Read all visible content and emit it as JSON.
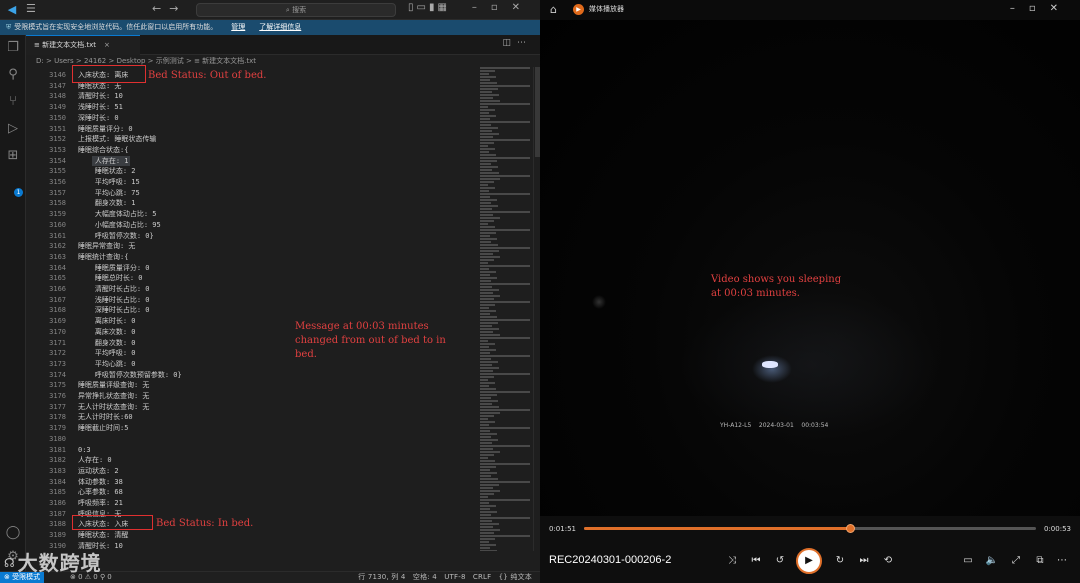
{
  "vscode": {
    "titlebar": {
      "search_placeholder": "搜索"
    },
    "banner": {
      "text": "受限模式旨在实现安全地浏览代码。信任此窗口以启用所有功能。",
      "manage_link": "管理",
      "learn_more_link": "了解详细信息"
    },
    "tab": {
      "label": "新建文本文档.txt",
      "close": "×"
    },
    "breadcrumb": "D: > Users > 24162 > Desktop > 示例测试 > ≡ 新建文本文档.txt",
    "code_lines": [
      {
        "n": "3146",
        "t": "入床状态: 离床"
      },
      {
        "n": "3147",
        "t": "睡眠状态: 无"
      },
      {
        "n": "3148",
        "t": "清醒时长: 10"
      },
      {
        "n": "3149",
        "t": "浅睡时长: 51"
      },
      {
        "n": "3150",
        "t": "深睡时长: 0"
      },
      {
        "n": "3151",
        "t": "睡眠质量评分: 0"
      },
      {
        "n": "3152",
        "t": "上报模式: 睡眠状态传输"
      },
      {
        "n": "3153",
        "t": "睡眠综合状态:{"
      },
      {
        "n": "3154",
        "t": "    人存在: 1"
      },
      {
        "n": "3155",
        "t": "    睡眠状态: 2"
      },
      {
        "n": "3156",
        "t": "    平均呼吸: 15"
      },
      {
        "n": "3157",
        "t": "    平均心跳: 75"
      },
      {
        "n": "3158",
        "t": "    翻身次数: 1"
      },
      {
        "n": "3159",
        "t": "    大幅度体动占比: 5"
      },
      {
        "n": "3160",
        "t": "    小幅度体动占比: 95"
      },
      {
        "n": "3161",
        "t": "    呼吸暂停次数: 0}"
      },
      {
        "n": "3162",
        "t": "睡眠异常查询: 无"
      },
      {
        "n": "3163",
        "t": "睡眠统计查询:{"
      },
      {
        "n": "3164",
        "t": "    睡眠质量评分: 0"
      },
      {
        "n": "3165",
        "t": "    睡眠总时长: 0"
      },
      {
        "n": "3166",
        "t": "    清醒时长占比: 0"
      },
      {
        "n": "3167",
        "t": "    浅睡时长占比: 0"
      },
      {
        "n": "3168",
        "t": "    深睡时长占比: 0"
      },
      {
        "n": "3169",
        "t": "    离床时长: 0"
      },
      {
        "n": "3170",
        "t": "    离床次数: 0"
      },
      {
        "n": "3171",
        "t": "    翻身次数: 0"
      },
      {
        "n": "3172",
        "t": "    平均呼吸: 0"
      },
      {
        "n": "3173",
        "t": "    平均心跳: 0"
      },
      {
        "n": "3174",
        "t": "    呼吸暂停次数预留参数: 0}"
      },
      {
        "n": "3175",
        "t": "睡眠质量评级查询: 无"
      },
      {
        "n": "3176",
        "t": "异常挣扎状态查询: 无"
      },
      {
        "n": "3177",
        "t": "无人计时状态查询: 无"
      },
      {
        "n": "3178",
        "t": "无人计时时长:60"
      },
      {
        "n": "3179",
        "t": "睡眠截止时间:5"
      },
      {
        "n": "3180",
        "t": ""
      },
      {
        "n": "3181",
        "t": "0:3"
      },
      {
        "n": "3182",
        "t": "人存在: 0"
      },
      {
        "n": "3183",
        "t": "运动状态: 2"
      },
      {
        "n": "3184",
        "t": "体动参数: 38"
      },
      {
        "n": "3185",
        "t": "心率参数: 68"
      },
      {
        "n": "3186",
        "t": "呼吸频率: 21"
      },
      {
        "n": "3187",
        "t": "呼吸信息: 无"
      },
      {
        "n": "3188",
        "t": "入床状态: 入床"
      },
      {
        "n": "3189",
        "t": "睡眠状态: 清醒"
      },
      {
        "n": "3190",
        "t": "清醒时长: 10"
      }
    ],
    "statusbar": {
      "remote": "⊗ 受限模式",
      "problems": "⊗ 0 ⚠ 0   ⚲ 0",
      "position": "行 7130, 列 4",
      "spaces": "空格: 4",
      "encoding": "UTF-8",
      "eol": "CRLF",
      "language": "{} 纯文本"
    }
  },
  "annotations": {
    "out_of_bed": "Bed Status: Out of bed.",
    "message": "Message at 00:03 minutes\nchanged from out of bed to in\nbed.",
    "in_bed": "Bed Status: In bed.",
    "video": "Video shows you sleeping\nat 00:03 minutes."
  },
  "watermark": "大数跨境",
  "player": {
    "app_title": "媒体播放器",
    "video_stamp": "YH-A12-L5    2024-03-01    00:03:54",
    "current_time": "0:01:51",
    "total_time": "0:00:53",
    "progress": 0.59,
    "filename": "REC20240301-000206-2",
    "icons": [
      "shuffle-icon",
      "previous-icon",
      "rewind-10-icon",
      "play-icon",
      "forward-30-icon",
      "next-icon",
      "repeat-off-icon",
      "captions-icon",
      "volume-icon",
      "fullscreen-icon",
      "mini-player-icon",
      "more-icon"
    ]
  }
}
